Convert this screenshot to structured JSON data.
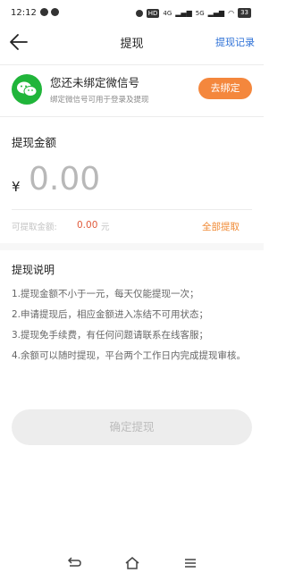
{
  "status_bar": {
    "time": "12:12",
    "battery": "33",
    "network": [
      "4G",
      "5G"
    ]
  },
  "header": {
    "title": "提现",
    "right_link": "提现记录"
  },
  "bind": {
    "title": "您还未绑定微信号",
    "subtitle": "绑定微信号可用于登录及提现",
    "button": "去绑定"
  },
  "amount": {
    "label": "提现金额",
    "currency": "¥",
    "value": "0.00"
  },
  "available": {
    "label": "可提取金额:",
    "value": "0.00",
    "unit": "元",
    "withdraw_all": "全部提取"
  },
  "instructions": {
    "title": "提现说明",
    "items": [
      "1.提现金额不小于一元，每天仅能提现一次；",
      "2.申请提现后，相应金额进入冻结不可用状态；",
      "3.提现免手续费，有任何问题请联系在线客服；",
      "4.余额可以随时提现，平台两个工作日内完成提现审核。"
    ]
  },
  "confirm_button": "确定提现",
  "colors": {
    "accent": "#f4873d",
    "link": "#2b6fd6",
    "wechat": "#20b53a",
    "alert": "#e05a3b"
  }
}
